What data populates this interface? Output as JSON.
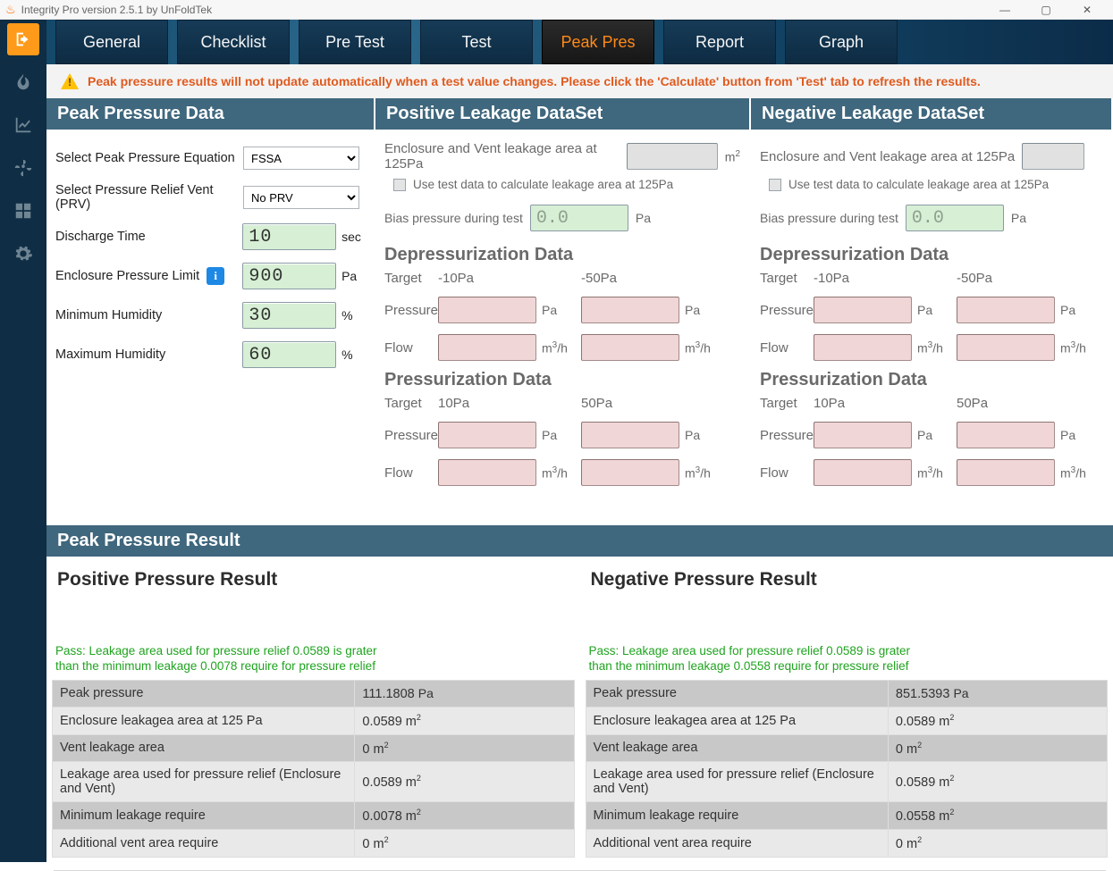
{
  "window": {
    "title": "Integrity Pro version 2.5.1 by UnFoldTek",
    "buttons": {
      "minimize": "—",
      "maximize": "▢",
      "close": "✕"
    }
  },
  "tabs": [
    "General",
    "Checklist",
    "Pre Test",
    "Test",
    "Peak Pres",
    "Report",
    "Graph"
  ],
  "active_tab": "Peak Pres",
  "rail": {
    "active_index": 0,
    "items": [
      "logout-icon",
      "flame-icon",
      "chart-icon",
      "fan-icon",
      "dashboard-icon",
      "gear-icon"
    ]
  },
  "warning": "Peak pressure results will not update automatically when a test value changes. Please click the 'Calculate' button from 'Test' tab to refresh the results.",
  "peak_pressure_data": {
    "title": "Peak Pressure Data",
    "equation_label": "Select Peak Pressure Equation",
    "equation_value": "FSSA",
    "prv_label": "Select Pressure Relief Vent (PRV)",
    "prv_value": "No PRV",
    "discharge_label": "Discharge Time",
    "discharge_value": "10",
    "discharge_unit": "sec",
    "limit_label": "Enclosure Pressure Limit",
    "limit_value": "900",
    "limit_unit": "Pa",
    "min_hum_label": "Minimum Humidity",
    "min_hum_value": "30",
    "min_hum_unit": "%",
    "max_hum_label": "Maximum Humidity",
    "max_hum_value": "60",
    "max_hum_unit": "%"
  },
  "leakage_common": {
    "enc_vent_label": "Enclosure and Vent leakage area at 125Pa",
    "enc_vent_unit_html": "m²",
    "checkbox_label": "Use test data to calculate leakage area at 125Pa",
    "bias_label": "Bias pressure during test",
    "bias_placeholder": "0.0",
    "bias_unit": "Pa",
    "dep_title": "Depressurization Data",
    "pres_title": "Pressurization Data",
    "rows": {
      "target": "Target",
      "pressure": "Pressure",
      "flow": "Flow"
    },
    "units": {
      "pressure": "Pa",
      "flow_html": "m³/h"
    }
  },
  "positive": {
    "title": "Positive Leakage DataSet",
    "dep_targets": [
      "-10Pa",
      "-50Pa"
    ],
    "pres_targets": [
      "10Pa",
      "50Pa"
    ]
  },
  "negative": {
    "title": "Negative Leakage DataSet",
    "dep_targets": [
      "-10Pa",
      "-50Pa"
    ],
    "pres_targets": [
      "10Pa",
      "50Pa"
    ]
  },
  "results": {
    "header": "Peak Pressure Result",
    "positive": {
      "title": "Positive Pressure Result",
      "pass_msg": "Pass: Leakage area used for pressure relief 0.0589 is grater than the minimum leakage 0.0078 require for pressure relief",
      "rows": [
        {
          "label": "Peak pressure",
          "value": "111.1808",
          "unit": "Pa"
        },
        {
          "label": "Enclosure leakagea area at 125 Pa",
          "value": "0.0589",
          "unit": "m²"
        },
        {
          "label": "Vent leakage area",
          "value": "0",
          "unit": "m²"
        },
        {
          "label": "Leakage area used for pressure relief (Enclosure and Vent)",
          "value": "0.0589",
          "unit": "m²"
        },
        {
          "label": "Minimum leakage require",
          "value": "0.0078",
          "unit": "m²"
        },
        {
          "label": "Additional vent area require",
          "value": "0",
          "unit": "m²"
        }
      ]
    },
    "negative": {
      "title": "Negative Pressure Result",
      "pass_msg": "Pass: Leakage area used for pressure relief 0.0589 is grater than the minimum leakage 0.0558 require for pressure relief",
      "rows": [
        {
          "label": "Peak pressure",
          "value": "851.5393",
          "unit": "Pa"
        },
        {
          "label": "Enclosure leakagea area at 125 Pa",
          "value": "0.0589",
          "unit": "m²"
        },
        {
          "label": "Vent leakage area",
          "value": "0",
          "unit": "m²"
        },
        {
          "label": "Leakage area used for pressure relief (Enclosure and Vent)",
          "value": "0.0589",
          "unit": "m²"
        },
        {
          "label": "Minimum leakage require",
          "value": "0.0558",
          "unit": "m²"
        },
        {
          "label": "Additional vent area require",
          "value": "0",
          "unit": "m²"
        }
      ]
    }
  }
}
